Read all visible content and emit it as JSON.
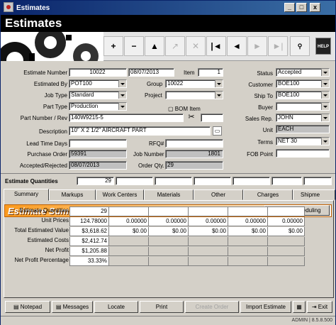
{
  "window": {
    "title": "Estimates",
    "minimize": "_",
    "maximize": "□",
    "close": "x"
  },
  "banner": {
    "title": "Estimates"
  },
  "toolbar": {
    "buttons": [
      "+",
      "−",
      "▲",
      "↗",
      "✕",
      "|◄",
      "◄",
      "►",
      "►|"
    ],
    "help": "HELP"
  },
  "form": {
    "estimate_number_label": "Estimate Number",
    "estimate_number": "10022",
    "estimate_date": "08/07/2013",
    "item_label": "Item",
    "item": "1",
    "estimated_by_label": "Estimated By",
    "estimated_by": "POT100",
    "group_label": "Group",
    "group": "10022",
    "job_type_label": "Job Type",
    "job_type": "Standard",
    "project_label": "Project",
    "project": "",
    "part_type_label": "Part Type",
    "part_type": "Production",
    "bom_item_label": "BOM Item",
    "part_number_label": "Part Number / Rev",
    "part_number": "140W9215-5",
    "rev": "",
    "description_label": "Description",
    "description": "10\" X 2 1/2\" AIRCRAFT PART",
    "lead_time_label": "Lead Time Days",
    "lead_time": "",
    "rfq_label": "RFQ#",
    "rfq": "",
    "purchase_order_label": "Purchase Order",
    "purchase_order": "59391",
    "job_number_label": "Job Number",
    "job_number": "1801",
    "accepted_label": "Accepted/Rejected",
    "accepted": "08/07/2013",
    "order_qty_label": "Order Qty.",
    "order_qty": "29",
    "status_label": "Status",
    "status": "Accepted",
    "customer_label": "Customer",
    "customer": "BOE100",
    "ship_to_label": "Ship To",
    "ship_to": "BOE100",
    "buyer_label": "Buyer",
    "buyer": "",
    "sales_rep_label": "Sales Rep.",
    "sales_rep": "JOHN",
    "unit_label": "Unit",
    "unit": "EACH",
    "terms_label": "Terms",
    "terms": "NET 30",
    "fob_label": "FOB Point",
    "fob": ""
  },
  "quantities": {
    "label": "Estimate Quantities",
    "values": [
      "29",
      "",
      "",
      "",
      "",
      "",
      ""
    ]
  },
  "tabs": [
    "Summary",
    "Markups",
    "Work Centers",
    "Materials",
    "Other",
    "Charges",
    "Shipme"
  ],
  "summary": {
    "title": "Estimate Summary",
    "what_if": "What If Scheduling",
    "rows": [
      {
        "label": "Estimate Quantities",
        "values": [
          "29",
          "",
          "",
          "",
          "",
          "",
          ""
        ]
      },
      {
        "label": "Unit Prices",
        "values": [
          "124.78000",
          "0.00000",
          "0.00000",
          "0.00000",
          "0.00000",
          "0.00000",
          "0.00000"
        ]
      },
      {
        "label": "Total Estimated Value",
        "values": [
          "$3,618.62",
          "$0.00",
          "$0.00",
          "$0.00",
          "$0.00",
          "$0.00",
          "$0.00"
        ]
      },
      {
        "label": "Estimated Costs",
        "values": [
          "$2,412.74",
          "",
          "",
          "",
          "",
          "",
          ""
        ]
      },
      {
        "label": "Net Profit",
        "values": [
          "$1,205.88",
          "",
          "",
          "",
          "",
          "",
          ""
        ]
      },
      {
        "label": "Net Profit Percentage",
        "values": [
          "33.33%",
          "",
          "",
          "",
          "",
          "",
          ""
        ]
      }
    ]
  },
  "buttons": {
    "notepad": "Notepad",
    "messages": "Messages",
    "locate": "Locate",
    "print": "Print",
    "create_order": "Create Order",
    "import_estimate": "Import Estimate",
    "exit": "Exit"
  },
  "statusbar": {
    "text": "ADMIN | 8.5.8.500"
  }
}
